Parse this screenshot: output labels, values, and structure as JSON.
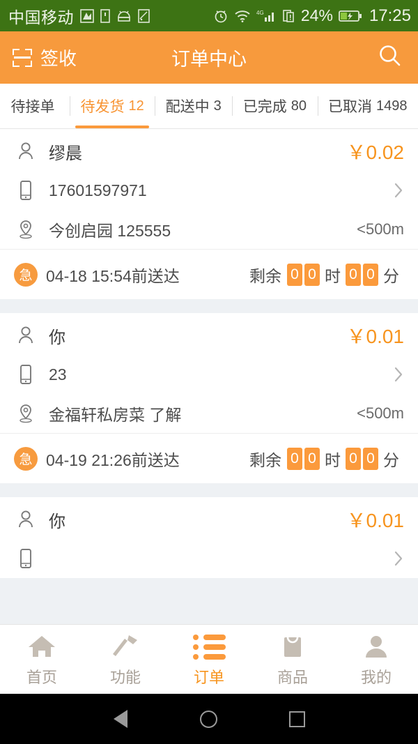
{
  "statusbar": {
    "carrier": "中国移动",
    "icons": [
      "signal-down-icon",
      "sim-icon",
      "android-icon",
      "sd-card-icon",
      "alarm-icon",
      "wifi-icon",
      "4g-signal-icon",
      "sim-alert-icon"
    ],
    "network_type": "4G",
    "battery_percent": "24%",
    "time": "17:25"
  },
  "appbar": {
    "scan_label": "签收",
    "title": "订单中心",
    "search_icon": "search-icon"
  },
  "tabs": [
    {
      "label": "待接单",
      "count": "",
      "active": false
    },
    {
      "label": "待发货",
      "count": "12",
      "active": true
    },
    {
      "label": "配送中",
      "count": "3",
      "active": false
    },
    {
      "label": "已完成",
      "count": "80",
      "active": false
    },
    {
      "label": "已取消",
      "count": "1498",
      "active": false
    }
  ],
  "orders": [
    {
      "customer": "缪晨",
      "price": "￥0.02",
      "phone": "17601597971",
      "address": "今创启园 125555",
      "distance": "<500m",
      "urgent_badge": "急",
      "deadline": "04-18 15:54前送达",
      "countdown": {
        "label": "剩余",
        "hours": [
          "0",
          "0"
        ],
        "hour_unit": "时",
        "minutes": [
          "0",
          "0"
        ],
        "minute_unit": "分"
      }
    },
    {
      "customer": "你",
      "price": "￥0.01",
      "phone": "23",
      "address": "金福轩私房菜 了解",
      "distance": "<500m",
      "urgent_badge": "急",
      "deadline": "04-19 21:26前送达",
      "countdown": {
        "label": "剩余",
        "hours": [
          "0",
          "0"
        ],
        "hour_unit": "时",
        "minutes": [
          "0",
          "0"
        ],
        "minute_unit": "分"
      }
    },
    {
      "customer": "你",
      "price": "￥0.01",
      "phone": "",
      "address": "",
      "distance": "",
      "urgent_badge": "",
      "deadline": "",
      "countdown": null
    }
  ],
  "bottomnav": [
    {
      "label": "首页",
      "icon": "home-icon",
      "active": false
    },
    {
      "label": "功能",
      "icon": "hammer-icon",
      "active": false
    },
    {
      "label": "订单",
      "icon": "list-icon",
      "active": true
    },
    {
      "label": "商品",
      "icon": "shopping-bag-icon",
      "active": false
    },
    {
      "label": "我的",
      "icon": "person-icon",
      "active": false
    }
  ],
  "androidnav": [
    "back-icon",
    "home-icon",
    "recents-icon"
  ],
  "colors": {
    "accent": "#f7941e",
    "header": "#f79a3d",
    "statusbar": "#3d7314",
    "page_bg": "#eef1f4"
  }
}
